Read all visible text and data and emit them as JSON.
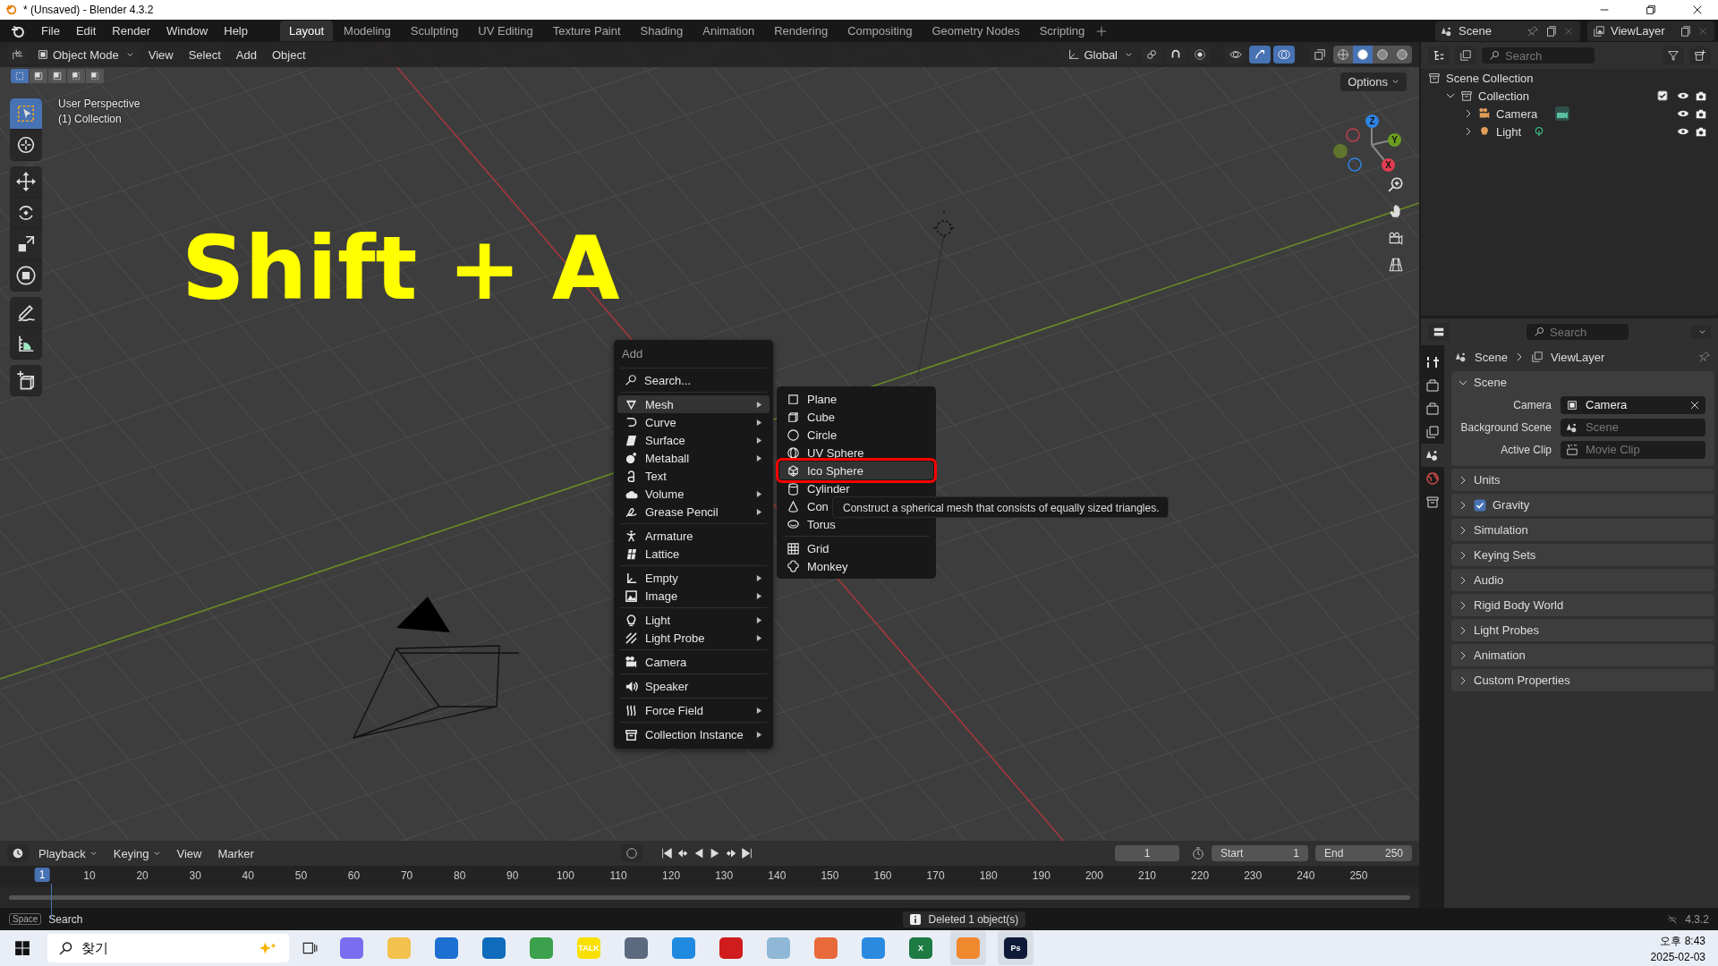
{
  "window": {
    "title": "* (Unsaved) - Blender 4.3.2"
  },
  "menu": [
    "File",
    "Edit",
    "Render",
    "Window",
    "Help"
  ],
  "workspaces": [
    {
      "label": "Layout",
      "selected": true
    },
    {
      "label": "Modeling",
      "selected": false
    },
    {
      "label": "Sculpting",
      "selected": false
    },
    {
      "label": "UV Editing",
      "selected": false
    },
    {
      "label": "Texture Paint",
      "selected": false
    },
    {
      "label": "Shading",
      "selected": false
    },
    {
      "label": "Animation",
      "selected": false
    },
    {
      "label": "Rendering",
      "selected": false
    },
    {
      "label": "Compositing",
      "selected": false
    },
    {
      "label": "Geometry Nodes",
      "selected": false
    },
    {
      "label": "Scripting",
      "selected": false
    }
  ],
  "scene": "Scene",
  "view_layer": "ViewLayer",
  "viewport": {
    "mode": "Object Mode",
    "menus": [
      "View",
      "Select",
      "Add",
      "Object"
    ],
    "orientation": "Global",
    "options": "Options",
    "select_modes": [
      {
        "selected": true
      },
      {
        "selected": false
      },
      {
        "selected": false
      },
      {
        "selected": false
      },
      {
        "selected": false
      }
    ],
    "toggles": [
      {
        "on": false
      },
      {
        "on": true
      },
      {
        "on": true
      }
    ],
    "shading": [
      {
        "selected": false
      },
      {
        "selected": true
      },
      {
        "selected": false
      },
      {
        "selected": false
      }
    ],
    "info": [
      "User Perspective",
      "(1) Collection"
    ],
    "caption": "Shift + A",
    "tools": [
      {
        "selected": true
      },
      {
        "selected": false
      },
      {
        "selected": false
      },
      {
        "selected": false
      },
      {
        "selected": false
      },
      {
        "selected": false
      },
      {
        "selected": false
      },
      {
        "selected": false
      },
      {
        "selected": false
      }
    ],
    "gizmo": [
      {
        "label": "Z",
        "color": "#2f83e3"
      },
      {
        "label": "Y",
        "color": "#6b9d1e"
      },
      {
        "label": "X",
        "color": "#e23d52"
      }
    ]
  },
  "add_menu": {
    "title": "Add",
    "search": "Search...",
    "groups": [
      [
        {
          "label": "Mesh",
          "submenu": true,
          "selected": true
        },
        {
          "label": "Curve",
          "submenu": true,
          "selected": false
        },
        {
          "label": "Surface",
          "submenu": true,
          "selected": false
        },
        {
          "label": "Metaball",
          "submenu": true,
          "selected": false
        },
        {
          "label": "Text",
          "submenu": false,
          "selected": false
        },
        {
          "label": "Volume",
          "submenu": true,
          "selected": false
        },
        {
          "label": "Grease Pencil",
          "submenu": true,
          "selected": false
        }
      ],
      [
        {
          "label": "Armature",
          "submenu": false,
          "selected": false
        },
        {
          "label": "Lattice",
          "submenu": false,
          "selected": false
        }
      ],
      [
        {
          "label": "Empty",
          "submenu": true,
          "selected": false
        },
        {
          "label": "Image",
          "submenu": true,
          "selected": false
        }
      ],
      [
        {
          "label": "Light",
          "submenu": true,
          "selected": false
        },
        {
          "label": "Light Probe",
          "submenu": true,
          "selected": false
        }
      ],
      [
        {
          "label": "Camera",
          "submenu": false,
          "selected": false
        }
      ],
      [
        {
          "label": "Speaker",
          "submenu": false,
          "selected": false
        }
      ],
      [
        {
          "label": "Force Field",
          "submenu": true,
          "selected": false
        }
      ],
      [
        {
          "label": "Collection Instance",
          "submenu": true,
          "selected": false
        }
      ]
    ]
  },
  "mesh_menu": {
    "groups": [
      [
        {
          "label": "Plane",
          "selected": false
        },
        {
          "label": "Cube",
          "selected": false
        },
        {
          "label": "Circle",
          "selected": false
        },
        {
          "label": "UV Sphere",
          "selected": false
        },
        {
          "label": "Ico Sphere",
          "selected": true
        },
        {
          "label": "Cylinder",
          "selected": false
        },
        {
          "label": "Con",
          "selected": false
        },
        {
          "label": "Torus",
          "selected": false
        }
      ],
      [
        {
          "label": "Grid",
          "selected": false
        },
        {
          "label": "Monkey",
          "selected": false
        }
      ]
    ],
    "tooltip": "Construct a spherical mesh that consists of equally sized triangles."
  },
  "outliner": {
    "search": {
      "placeholder": "Search"
    },
    "tree": [
      {
        "label": "Scene Collection",
        "children": [
          {
            "label": "Collection",
            "expanded": true,
            "checked": true,
            "children": [
              {
                "label": "Camera",
                "expanded": false
              },
              {
                "label": "Light",
                "expanded": false
              }
            ]
          }
        ]
      }
    ]
  },
  "properties": {
    "search": {
      "placeholder": "Search"
    },
    "tabs": [
      {
        "selected": false
      },
      {
        "selected": false
      },
      {
        "selected": false
      },
      {
        "selected": false
      },
      {
        "selected": true
      },
      {
        "selected": false
      },
      {
        "selected": false
      }
    ],
    "breadcrumb": [
      "Scene",
      "ViewLayer"
    ],
    "panel": {
      "title": "Scene",
      "expanded": true,
      "fields": [
        {
          "label": "Camera",
          "value": "Camera"
        },
        {
          "label": "Background Scene",
          "placeholder": "Scene"
        },
        {
          "label": "Active Clip",
          "placeholder": "Movie Clip"
        }
      ]
    },
    "sections": [
      {
        "label": "Units",
        "kind": "plain"
      },
      {
        "label": "Gravity",
        "kind": "checkbox",
        "checked": true
      },
      {
        "label": "Simulation",
        "kind": "plain"
      },
      {
        "label": "Keying Sets",
        "kind": "plain"
      },
      {
        "label": "Audio",
        "kind": "plain"
      },
      {
        "label": "Rigid Body World",
        "kind": "plain"
      },
      {
        "label": "Light Probes",
        "kind": "plain"
      },
      {
        "label": "Animation",
        "kind": "plain"
      },
      {
        "label": "Custom Properties",
        "kind": "plain"
      }
    ]
  },
  "timeline": {
    "menus": [
      "Playback",
      "Keying",
      "View",
      "Marker"
    ],
    "current_frame": "1",
    "start_label": "Start",
    "start": "1",
    "end_label": "End",
    "end": "250",
    "ruler": [
      "1",
      "10",
      "20",
      "30",
      "40",
      "50",
      "60",
      "70",
      "80",
      "90",
      "100",
      "110",
      "120",
      "130",
      "140",
      "150",
      "160",
      "170",
      "180",
      "190",
      "200",
      "210",
      "220",
      "230",
      "240",
      "250"
    ]
  },
  "status_bar": {
    "key": "Space",
    "action": "Search",
    "message": "Deleted 1 object(s)",
    "version": "4.3.2"
  },
  "taskbar": {
    "search": "찾기",
    "apps": [
      {
        "color": "#7b6cf0",
        "running": false
      },
      {
        "color": "#f2c14e",
        "running": false
      },
      {
        "color": "#1d6fd1",
        "running": false
      },
      {
        "color": "#0f6cbd",
        "running": false
      },
      {
        "color": "#3ba14c",
        "running": false
      },
      {
        "color": "#f9e000",
        "glyph": "TALK",
        "running": false
      },
      {
        "color": "#5b6a7e",
        "running": false
      },
      {
        "color": "#1f8ae0",
        "running": false
      },
      {
        "color": "#d01c1c",
        "running": false
      },
      {
        "color": "#8fb8d6",
        "running": false
      },
      {
        "color": "#e86a3a",
        "running": false
      },
      {
        "color": "#2a8ae0",
        "running": false
      },
      {
        "color": "#1d7a43",
        "glyph": "X",
        "running": false
      },
      {
        "color": "#f0882e",
        "running": true
      },
      {
        "color": "#0d1b38",
        "glyph": "Ps",
        "running": true
      }
    ],
    "time": "오후 8:43",
    "date": "2025-02-03"
  }
}
